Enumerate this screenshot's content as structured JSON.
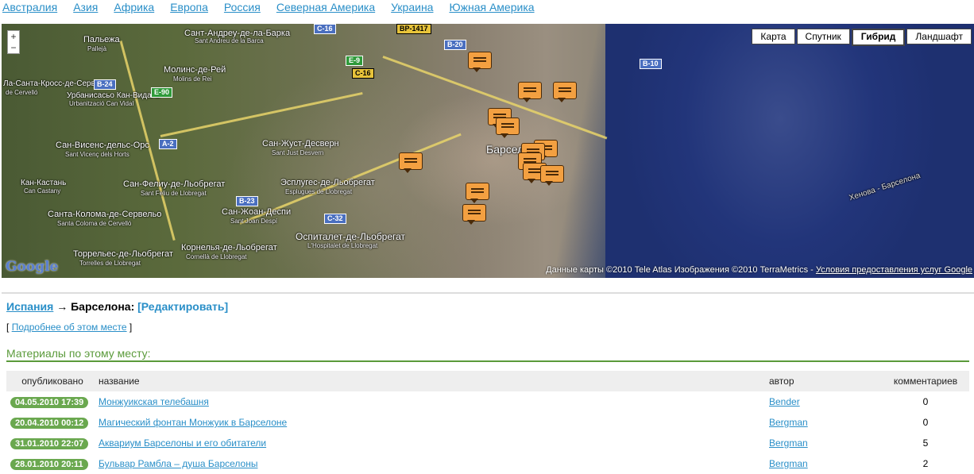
{
  "regions": [
    "Австралия",
    "Азия",
    "Африка",
    "Европа",
    "Россия",
    "Северная Америка",
    "Украина",
    "Южная Америка"
  ],
  "map": {
    "zoom_in": "+",
    "zoom_out": "−",
    "types": [
      "Карта",
      "Спутник",
      "Гибрид",
      "Ландшафт"
    ],
    "active_type": "Гибрид",
    "copyright_text": "Данные карты ©2010 Tele Atlas Изображения ©2010 TerraMetrics - ",
    "terms_link": "Условия предоставления услуг Google",
    "logo": "Google",
    "labels": {
      "palleja": "Пальежа",
      "palleja_sub": "Pallejà",
      "sant_andreu": "Сант-Андреу-де-ла-Барка",
      "sant_andreu_sub": "Sant Andreu de la Barca",
      "molins": "Молинс-де-Рей",
      "molins_sub": "Molins de Rei",
      "cervello": "Ла-Санта-Кросс-де-Сервельо",
      "cervello_sub": "de Cervelló",
      "urbanitzacio": "Урбанисасьо Кан-Видаль",
      "urbanitzacio_sub": "Urbanització Can Vidal",
      "sant_vicenc": "Сан-Висенс-дельс-Орс",
      "sant_vicenc_sub": "Sant Vicenç dels Horts",
      "can_castany": "Кан-Кастань",
      "can_castany_sub": "Can Castany",
      "sant_just": "Сан-Жуст-Десверн",
      "sant_just_sub": "Sant Just Desvern",
      "sant_feliu": "Сан-Фелиу-де-Льобрегат",
      "sant_feliu_sub": "Sant Feliu de Llobregat",
      "esplugues": "Эсплугес-де-Льобрегат",
      "esplugues_sub": "Esplugues de Llobregat",
      "santa_coloma": "Санта-Колома-де-Сервельо",
      "santa_coloma_sub": "Santa Coloma de Cervelló",
      "sant_joan": "Сан-Жоан-Деспи",
      "sant_joan_sub": "Sant Joan Despí",
      "barcelona": "Барселона",
      "hospitalet": "Оспиталет-де-Льобрегат",
      "hospitalet_sub": "L'Hospitalet de Llobregat",
      "torrelles": "Торрельес-де-Льобрегат",
      "torrelles_sub": "Torrelles de Llobregat",
      "cornella": "Корнелья-де-Льобрегат",
      "cornella_sub": "Cornellà de Llobregat",
      "ferry": "Хенова - Барселона"
    },
    "shields": {
      "c16": "C-16",
      "bp1417": "BP-1417",
      "b20": "B-20",
      "e9": "E-9",
      "c16b": "C-16",
      "b24": "B-24",
      "e90": "E-90",
      "b10": "B-10",
      "a2": "A-2",
      "b23": "B-23",
      "c32": "C-32"
    },
    "marker_count": 12
  },
  "breadcrumb": {
    "country": "Испания",
    "arrow": "→",
    "city": "Барселона:",
    "edit": "[Редактировать]"
  },
  "more": {
    "open": "[",
    "link": "Подробнее об этом месте",
    "close": "]"
  },
  "section_title": "Материалы по этому месту:",
  "table": {
    "headers": [
      "опубликовано",
      "название",
      "автор",
      "комментариев"
    ],
    "rows": [
      {
        "date": "04.05.2010 17:39",
        "title": "Монжуикская телебашня",
        "author": "Bender",
        "comments": "0"
      },
      {
        "date": "20.04.2010 00:12",
        "title": "Магический фонтан Монжуик в Барселоне",
        "author": "Bergman",
        "comments": "0"
      },
      {
        "date": "31.01.2010 22:07",
        "title": "Аквариум Барселоны и его обитатели",
        "author": "Bergman",
        "comments": "5"
      },
      {
        "date": "28.01.2010 20:11",
        "title": "Бульвар Рамбла – душа Барселоны",
        "author": "Bergman",
        "comments": "2"
      }
    ]
  }
}
